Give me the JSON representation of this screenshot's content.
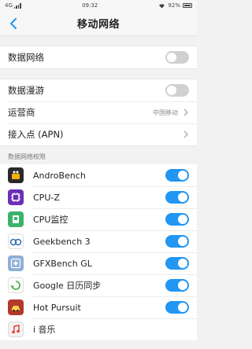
{
  "status_bar": {
    "network": "4G",
    "time": "09:32",
    "battery": "92%"
  },
  "nav": {
    "title": "移动网络"
  },
  "mobile_data": {
    "label": "数据网络",
    "toggle": "off"
  },
  "roaming_group": {
    "roaming": {
      "label": "数据漫游",
      "toggle": "off"
    },
    "carrier": {
      "label": "运营商",
      "value": "中国移动"
    },
    "apn": {
      "label": "接入点 (APN)"
    }
  },
  "permissions": {
    "header": "数据网络权限",
    "apps": [
      {
        "name": "AndroBench",
        "icon": "androbench-icon",
        "color": "#2a2a2a",
        "enabled": true
      },
      {
        "name": "CPU-Z",
        "icon": "cpu-z-icon",
        "color": "#6a2fb6",
        "enabled": true
      },
      {
        "name": "CPU监控",
        "icon": "cpu-monitor-icon",
        "color": "#3bb36a",
        "enabled": true
      },
      {
        "name": "Geekbench 3",
        "icon": "geekbench-icon",
        "color": "#3d6fb0",
        "enabled": true
      },
      {
        "name": "GFXBench GL",
        "icon": "gfxbench-icon",
        "color": "#8fb0d6",
        "enabled": true
      },
      {
        "name": "Google 日历同步",
        "icon": "google-calendar-sync-icon",
        "color": "#4caf50",
        "enabled": true
      },
      {
        "name": "Hot Pursuit",
        "icon": "hot-pursuit-icon",
        "color": "#b33a2a",
        "enabled": true
      },
      {
        "name": "i 音乐",
        "icon": "i-music-icon",
        "color": "#e8e8e8",
        "enabled": null
      }
    ]
  },
  "colors": {
    "accent": "#2196f3",
    "toggle_off": "#d0d0d0"
  }
}
